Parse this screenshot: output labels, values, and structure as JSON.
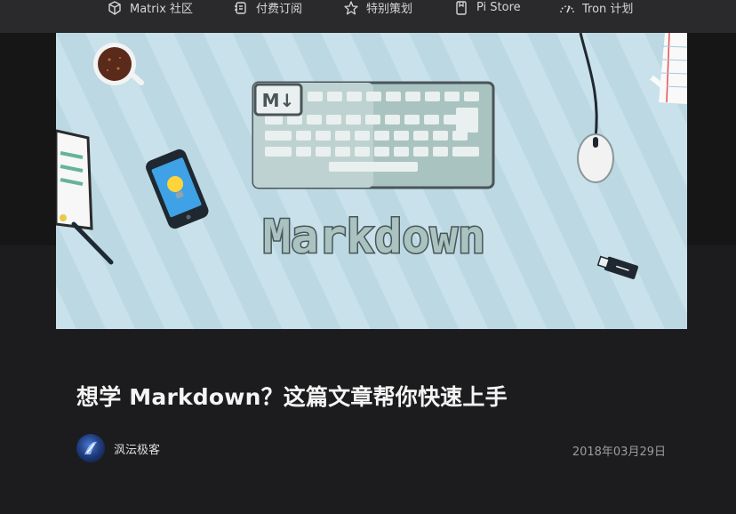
{
  "nav": {
    "items": [
      {
        "label": "Matrix 社区",
        "icon": "cube-icon"
      },
      {
        "label": "付费订阅",
        "icon": "subscription-icon"
      },
      {
        "label": "特别策划",
        "icon": "star-icon"
      },
      {
        "label": "Pi Store",
        "icon": "bookmark-icon"
      },
      {
        "label": "Tron 计划",
        "icon": "gauge-icon"
      }
    ]
  },
  "hero": {
    "caption_text": "Markdown",
    "key_label": "M↓"
  },
  "article": {
    "title": "想学 Markdown？这篇文章帮你快速上手",
    "author": "沨沄极客",
    "date": "2018年03月29日"
  },
  "colors": {
    "page_bg": "#1c1c1e",
    "nav_bg": "#2a2a2c",
    "hero_bg": "#c8e1ea",
    "title_text": "#f4f4f4",
    "date_text": "#9c9c9c"
  }
}
